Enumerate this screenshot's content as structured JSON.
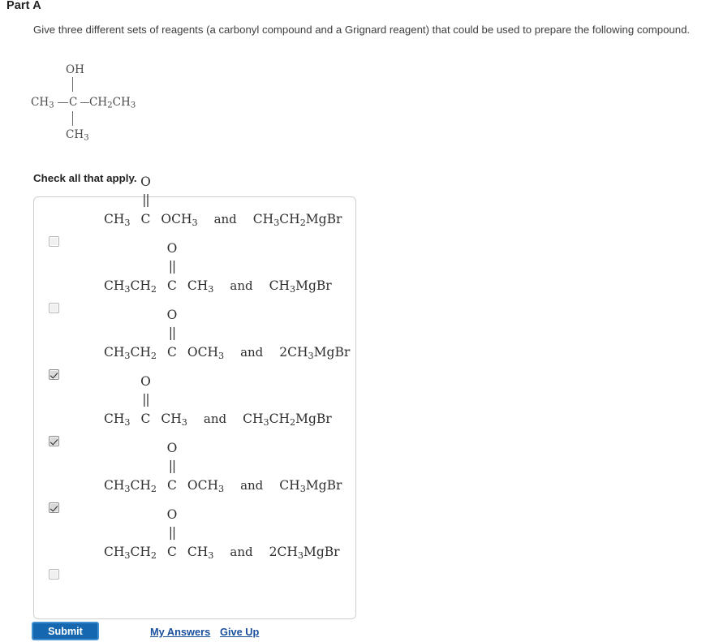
{
  "header": {
    "part_title": "Part A",
    "question": "Give three different sets of reagents (a carbonyl compound and a Grignard reagent) that could be used to prepare the following compound."
  },
  "structure": {
    "description": "2-methyl-2-butanol skeletal formula",
    "top_group": "OH",
    "left_group": "CH3",
    "center_atom": "C",
    "right_group": "CH2CH3",
    "bottom_group": "CH3"
  },
  "instructions": {
    "check_all": "Check all that apply."
  },
  "options": [
    {
      "checked": false,
      "carbonyl_left": "CH3",
      "carbonyl_o": "O",
      "carbonyl_dbl": "||",
      "carbonyl_c": "C",
      "carbonyl_right": "OCH3",
      "conjunction": "and",
      "grignard": "CH3CH2MgBr"
    },
    {
      "checked": false,
      "carbonyl_left": "CH3CH2",
      "carbonyl_o": "O",
      "carbonyl_dbl": "||",
      "carbonyl_c": "C",
      "carbonyl_right": "CH3",
      "conjunction": "and",
      "grignard": "CH3MgBr"
    },
    {
      "checked": true,
      "carbonyl_left": "CH3CH2",
      "carbonyl_o": "O",
      "carbonyl_dbl": "||",
      "carbonyl_c": "C",
      "carbonyl_right": "OCH3",
      "conjunction": "and",
      "grignard": "2CH3MgBr"
    },
    {
      "checked": true,
      "carbonyl_left": "CH3",
      "carbonyl_o": "O",
      "carbonyl_dbl": "||",
      "carbonyl_c": "C",
      "carbonyl_right": "CH3",
      "conjunction": "and",
      "grignard": "CH3CH2MgBr"
    },
    {
      "checked": true,
      "carbonyl_left": "CH3CH2",
      "carbonyl_o": "O",
      "carbonyl_dbl": "||",
      "carbonyl_c": "C",
      "carbonyl_right": "OCH3",
      "conjunction": "and",
      "grignard": "CH3MgBr"
    },
    {
      "checked": false,
      "carbonyl_left": "CH3CH2",
      "carbonyl_o": "O",
      "carbonyl_dbl": "||",
      "carbonyl_c": "C",
      "carbonyl_right": "CH3",
      "conjunction": "and",
      "grignard": "2CH3MgBr"
    }
  ],
  "footer": {
    "submit_label": "Submit",
    "my_answers_label": "My Answers",
    "give_up_label": "Give Up"
  },
  "colors": {
    "submit_blue": "#1568b0",
    "submit_border": "#3e8ed0",
    "link_blue": "#1a4f9c",
    "box_border": "#cfcfcf"
  }
}
